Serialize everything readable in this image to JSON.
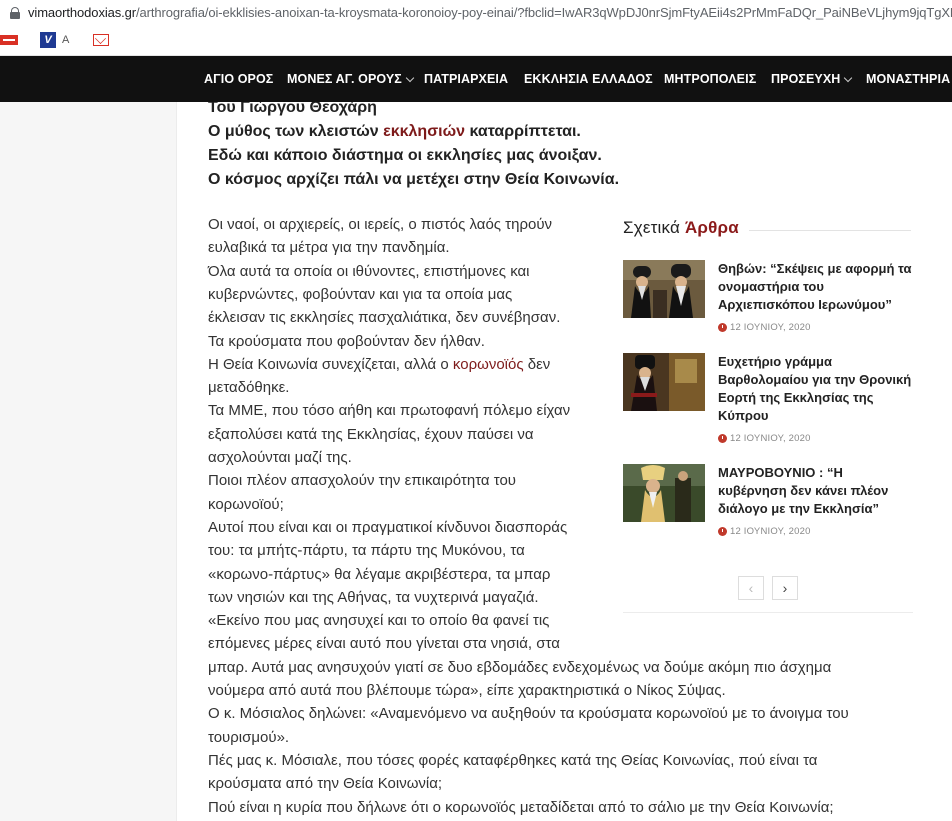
{
  "browser": {
    "url_host": "vimaorthodoxias.gr",
    "url_path": "/arthrografia/oi-ekklisies-anoixan-ta-kroysmata-koronoioy-poy-einai/?fbclid=IwAR3qWpDJ0nrSjmFtyAEii4s2PrMmFaDQr_PaiNBeVLjhym9jqTgXH2jS",
    "bookmark_a": "A"
  },
  "nav": {
    "items": [
      {
        "label": "ΑΓΙΟ ΟΡΟΣ",
        "dropdown": false
      },
      {
        "label": "ΜΟΝΕΣ ΑΓ. ΟΡΟΥΣ",
        "dropdown": true
      },
      {
        "label": "ΠΑΤΡΙΑΡΧΕΙΑ",
        "dropdown": false
      },
      {
        "label": "ΕΚΚΛΗΣΙΑ ΕΛΛΑΔΟΣ",
        "dropdown": false
      },
      {
        "label": "ΜΗΤΡΟΠΟΛΕΙΣ",
        "dropdown": false
      },
      {
        "label": "ΠΡΟΣΕΥΧΗ",
        "dropdown": true
      },
      {
        "label": "ΜΟΝΑΣΤΗΡΙΑ Τ",
        "dropdown": false
      }
    ]
  },
  "article": {
    "intro": [
      {
        "pre": "Του Γιώργου Θεοχάρη",
        "link": "",
        "post": ""
      },
      {
        "pre": "Ο μύθος των κλειστών ",
        "link": "εκκλησιών",
        "post": " καταρρίπτεται."
      },
      {
        "pre": "Εδώ και κάποιο διάστημα οι εκκλησίες μας άνοιξαν.",
        "link": "",
        "post": ""
      },
      {
        "pre": "Ο κόσμος αρχίζει πάλι να μετέχει στην Θεία Κοινωνία.",
        "link": "",
        "post": ""
      }
    ],
    "lines": [
      {
        "pre": "Οι ναοί, οι αρχιερείς, οι ιερείς, ο πιστός λαός τηρούν",
        "link": "",
        "post": ""
      },
      {
        "pre": "ευλαβικά τα μέτρα για την πανδημία.",
        "link": "",
        "post": ""
      },
      {
        "pre": "Όλα αυτά τα οποία οι ιθύνοντες, επιστήμονες και",
        "link": "",
        "post": ""
      },
      {
        "pre": "κυβερνώντες, φοβούνταν και για τα οποία μας",
        "link": "",
        "post": ""
      },
      {
        "pre": "έκλεισαν τις εκκλησίες πασχαλιάτικα, δεν συνέβησαν.",
        "link": "",
        "post": ""
      },
      {
        "pre": "Τα κρούσματα που φοβούνταν δεν ήλθαν.",
        "link": "",
        "post": ""
      },
      {
        "pre": "Η Θεία Κοινωνία συνεχίζεται, αλλά ο ",
        "link": "κορωνοϊός",
        "post": " δεν"
      },
      {
        "pre": "μεταδόθηκε.",
        "link": "",
        "post": ""
      },
      {
        "pre": "Τα ΜΜΕ, που τόσο αήθη και πρωτοφανή πόλεμο είχαν",
        "link": "",
        "post": ""
      },
      {
        "pre": "εξαπολύσει κατά της Εκκλησίας, έχουν παύσει να",
        "link": "",
        "post": ""
      },
      {
        "pre": "ασχολούνται μαζί της.",
        "link": "",
        "post": ""
      },
      {
        "pre": "Ποιοι πλέον απασχολούν την επικαιρότητα του",
        "link": "",
        "post": ""
      },
      {
        "pre": "κορωνοϊού;",
        "link": "",
        "post": ""
      },
      {
        "pre": "Αυτοί που είναι και οι πραγματικοί κίνδυνοι διασποράς",
        "link": "",
        "post": ""
      },
      {
        "pre": "του: τα μπήτς-πάρτυ, τα πάρτυ της Μυκόνου, τα",
        "link": "",
        "post": ""
      },
      {
        "pre": "«κορωνο-πάρτυς» θα λέγαμε ακριβέστερα, τα μπαρ",
        "link": "",
        "post": ""
      },
      {
        "pre": "των νησιών και της Αθήνας, τα νυχτερινά μαγαζιά.",
        "link": "",
        "post": ""
      },
      {
        "pre": "«Εκείνο που μας ανησυχεί και το οποίο θα φανεί τις",
        "link": "",
        "post": ""
      },
      {
        "pre": "επόμενες μέρες είναι αυτό που γίνεται στα νησιά, στα",
        "link": "",
        "post": ""
      },
      {
        "pre": "μπαρ. Αυτά μας ανησυχούν γιατί σε δυο εβδομάδες ενδεχομένως να δούμε ακόμη πιο άσχημα",
        "link": "",
        "post": ""
      },
      {
        "pre": "νούμερα από αυτά που βλέπουμε τώρα», είπε χαρακτηριστικά ο Νίκος Σύψας.",
        "link": "",
        "post": ""
      },
      {
        "pre": "Ο κ. Μόσιαλος δηλώνει: «Αναμενόμενο να αυξηθούν τα κρούσματα κορωνοϊού με το άνοιγμα του",
        "link": "",
        "post": ""
      },
      {
        "pre": "τουρισμού».",
        "link": "",
        "post": ""
      },
      {
        "pre": "Πές μας κ. Μόσιαλε, που τόσες φορές καταφέρθηκες κατά της Θείας Κοινωνίας, πού είναι τα",
        "link": "",
        "post": ""
      },
      {
        "pre": "κρούσματα από την Θεία Κοινωνία;",
        "link": "",
        "post": ""
      },
      {
        "pre": "Πού είναι η κυρία που δήλωνε ότι ο κορωνοϊός μεταδίδεται από το σάλιο με την Θεία Κοινωνία;",
        "link": "",
        "post": ""
      }
    ]
  },
  "related": {
    "title_plain": "Σχετικά ",
    "title_highlight": "Άρθρα",
    "items": [
      {
        "title": "Θηβών: “Σκέψεις με αφορμή τα ονομαστήρια του Αρχιεπισκόπου Ιερωνύμου”",
        "date": "12 ΙΟΥΝΙΟΥ, 2020"
      },
      {
        "title": "Ευχετήριο γράμμα Βαρθολομαίου για την Θρονική Εορτή της Εκκλησίας της Κύπρου",
        "date": "12 ΙΟΥΝΙΟΥ, 2020"
      },
      {
        "title": "ΜΑΥΡΟΒΟΥΝΙΟ : “Η κυβέρνηση δεν κάνει πλέον διάλογο με την Εκκλησία”",
        "date": "12 ΙΟΥΝΙΟΥ, 2020"
      }
    ],
    "prev_label": "‹",
    "next_label": "›"
  }
}
